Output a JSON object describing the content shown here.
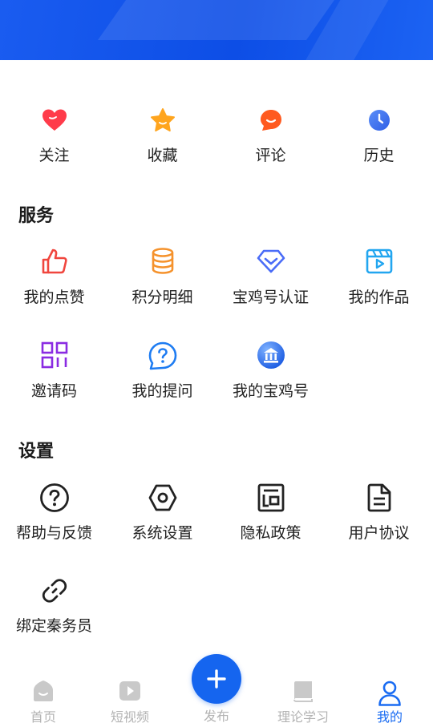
{
  "quick_actions": [
    {
      "label": "关注",
      "icon": "heart-icon",
      "color": "#ff3b3b"
    },
    {
      "label": "收藏",
      "icon": "star-icon",
      "color": "#ffa21a"
    },
    {
      "label": "评论",
      "icon": "comment-icon",
      "color": "#ff5a1f"
    },
    {
      "label": "历史",
      "icon": "clock-icon",
      "color": "#3d7bf5"
    }
  ],
  "services": {
    "title": "服务",
    "items": [
      {
        "label": "我的点赞",
        "icon": "thumbs-up-icon",
        "color": "#f0463e"
      },
      {
        "label": "积分明细",
        "icon": "coins-stack-icon",
        "color": "#f5922c"
      },
      {
        "label": "宝鸡号认证",
        "icon": "diamond-badge-icon",
        "color": "#4a6cf7"
      },
      {
        "label": "我的作品",
        "icon": "video-clip-icon",
        "color": "#22a6f0"
      },
      {
        "label": "邀请码",
        "icon": "qr-code-icon",
        "color": "#8a2be2"
      },
      {
        "label": "我的提问",
        "icon": "question-bubble-icon",
        "color": "#1e7cf2"
      },
      {
        "label": "我的宝鸡号",
        "icon": "museum-badge-icon",
        "color": "#1e6cf2"
      }
    ]
  },
  "settings": {
    "title": "设置",
    "items": [
      {
        "label": "帮助与反馈",
        "icon": "help-circle-icon"
      },
      {
        "label": "系统设置",
        "icon": "hexagon-gear-icon"
      },
      {
        "label": "隐私政策",
        "icon": "document-frame-icon"
      },
      {
        "label": "用户协议",
        "icon": "file-text-icon"
      },
      {
        "label": "绑定秦务员",
        "icon": "link-icon"
      }
    ]
  },
  "tabbar": {
    "items": [
      {
        "label": "首页",
        "icon": "home-icon"
      },
      {
        "label": "短视频",
        "icon": "play-icon"
      },
      {
        "label": "发布",
        "icon": "plus-icon"
      },
      {
        "label": "理论学习",
        "icon": "book-icon"
      },
      {
        "label": "我的",
        "icon": "person-icon",
        "active": true
      }
    ],
    "active_color": "#1a6cf2",
    "inactive_color": "#b3b3b3"
  },
  "header": {
    "background_color": "#0d4ee6"
  }
}
